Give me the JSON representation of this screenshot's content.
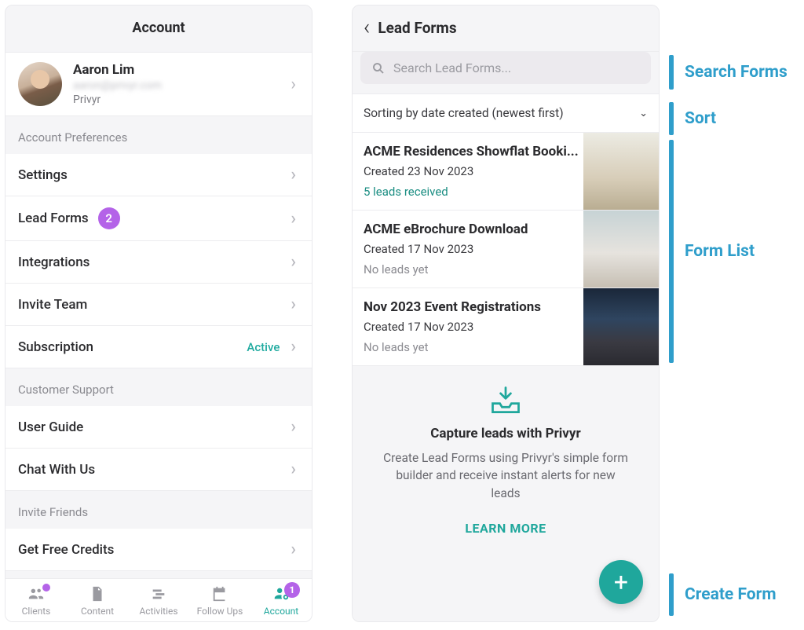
{
  "left": {
    "header_title": "Account",
    "profile": {
      "name": "Aaron Lim",
      "email": "aaron@privyr.com",
      "org": "Privyr"
    },
    "sections": {
      "prefs_label": "Account Preferences",
      "support_label": "Customer Support",
      "invite_label": "Invite Friends"
    },
    "rows": {
      "settings": "Settings",
      "lead_forms": "Lead Forms",
      "lead_forms_badge": "2",
      "integrations": "Integrations",
      "invite_team": "Invite Team",
      "subscription": "Subscription",
      "subscription_status": "Active",
      "user_guide": "User Guide",
      "chat": "Chat With Us",
      "free_credits": "Get Free Credits"
    },
    "tabs": {
      "clients": "Clients",
      "content": "Content",
      "activities": "Activities",
      "followups": "Follow Ups",
      "account": "Account",
      "account_badge": "1"
    }
  },
  "right": {
    "header_title": "Lead Forms",
    "search_placeholder": "Search Lead Forms...",
    "sort_label": "Sorting by date created (newest first)",
    "forms": [
      {
        "title": "ACME Residences Showflat Booki...",
        "created": "Created 23 Nov 2023",
        "leads": "5 leads received",
        "has_leads": true
      },
      {
        "title": "ACME eBrochure Download",
        "created": "Created 17 Nov 2023",
        "leads": "No leads yet",
        "has_leads": false
      },
      {
        "title": "Nov 2023 Event Registrations",
        "created": "Created 17 Nov 2023",
        "leads": "No leads yet",
        "has_leads": false
      }
    ],
    "promo": {
      "title": "Capture leads with Privyr",
      "desc": "Create Lead Forms using Privyr's simple form builder and receive instant alerts for new leads",
      "cta": "LEARN MORE"
    }
  },
  "annotations": {
    "search": "Search Forms",
    "sort": "Sort",
    "list": "Form List",
    "create": "Create Form"
  }
}
